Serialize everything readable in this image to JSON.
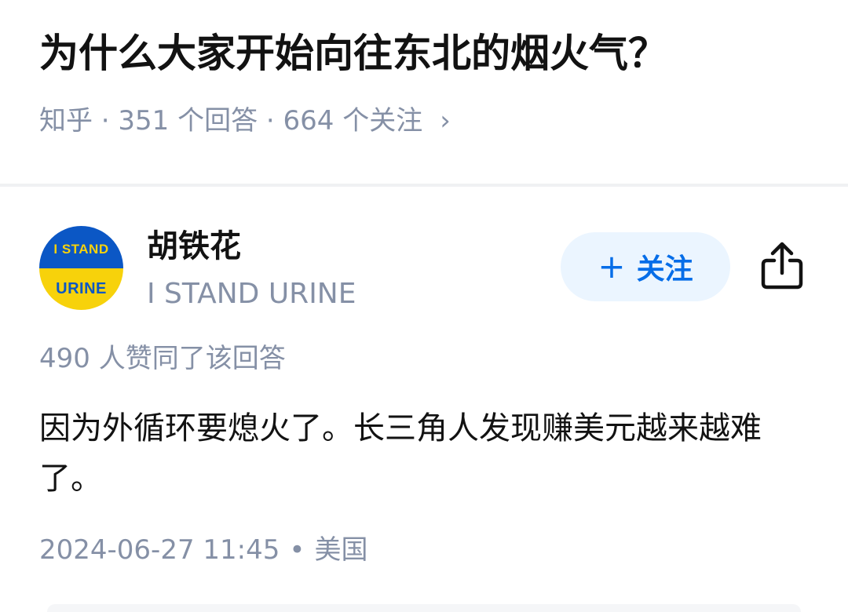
{
  "question": {
    "title": "为什么大家开始向往东北的烟火气？",
    "meta": "知乎 · 351 个回答 · 664 个关注",
    "chevron": "›"
  },
  "author": {
    "avatar_text_top": "I STAND",
    "avatar_text_bottom": "URINE",
    "name": "胡铁花",
    "headline": "I STAND URINE"
  },
  "actions": {
    "follow_plus": "+",
    "follow_label": "关注",
    "share_icon": "share-icon"
  },
  "answer": {
    "votes": "490 人赞同了该回答",
    "content": "因为外循环要熄火了。长三角人发现赚美元越来越难了。",
    "timestamp": "2024-06-27 11:45",
    "separator": "•",
    "location": "美国"
  },
  "colors": {
    "accent": "#056de8",
    "follow_bg": "#ebf5ff",
    "muted": "#8590a6",
    "avatar_blue": "#0b57c5",
    "avatar_yellow": "#f7d20b"
  }
}
